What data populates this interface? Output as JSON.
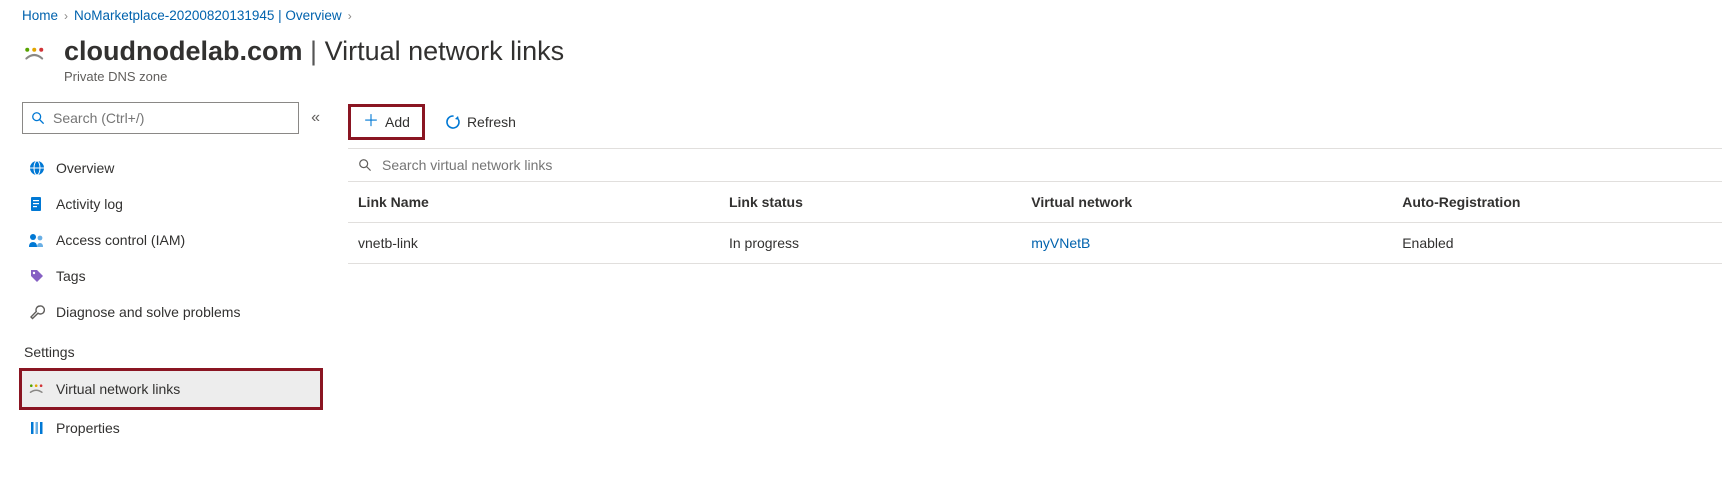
{
  "breadcrumb": {
    "items": [
      {
        "label": "Home"
      },
      {
        "label": "NoMarketplace-20200820131945 | Overview"
      }
    ]
  },
  "header": {
    "title_strong": "cloudnodelab.com",
    "title_rest": "Virtual network links",
    "subtitle": "Private DNS zone"
  },
  "sidebar": {
    "search_placeholder": "Search (Ctrl+/)",
    "items": {
      "overview": "Overview",
      "activity": "Activity log",
      "iam": "Access control (IAM)",
      "tags": "Tags",
      "diagnose": "Diagnose and solve problems"
    },
    "settings_heading": "Settings",
    "settings": {
      "vnet_links": "Virtual network links",
      "properties": "Properties"
    }
  },
  "toolbar": {
    "add": "Add",
    "refresh": "Refresh"
  },
  "main": {
    "search_placeholder": "Search virtual network links",
    "columns": {
      "link_name": "Link Name",
      "link_status": "Link status",
      "vnet": "Virtual network",
      "autoreg": "Auto-Registration"
    },
    "rows": [
      {
        "link_name": "vnetb-link",
        "link_status": "In progress",
        "vnet": "myVNetB",
        "autoreg": "Enabled"
      }
    ]
  }
}
